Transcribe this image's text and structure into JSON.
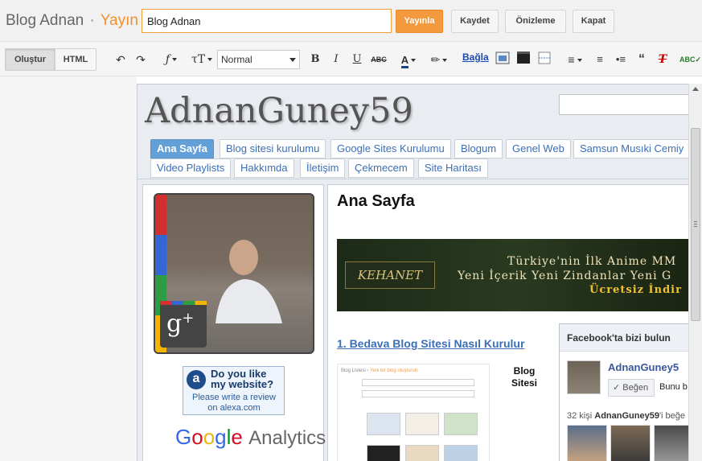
{
  "header": {
    "app_name": "Blog Adnan",
    "separator": "·",
    "section": "Yayın",
    "post_title_value": "Blog Adnan",
    "buttons": {
      "publish": "Yayınla",
      "save": "Kaydet",
      "preview": "Önizleme",
      "close": "Kapat"
    }
  },
  "toolbar": {
    "mode_compose": "Oluştur",
    "mode_html": "HTML",
    "format_value": "Normal",
    "link_label": "Bağla",
    "icons": [
      "undo-icon",
      "redo-icon",
      "font-icon",
      "font-size-icon",
      "bold-icon",
      "italic-icon",
      "underline-icon",
      "strikethrough-icon",
      "text-color-icon",
      "highlight-icon",
      "image-icon",
      "video-icon",
      "jump-break-icon",
      "align-icon",
      "numbered-list-icon",
      "bullet-list-icon",
      "quote-icon",
      "remove-format-icon",
      "spellcheck-icon"
    ]
  },
  "blog": {
    "logo_text": "AdnanGuney59",
    "tabs": [
      {
        "label": "Ana Sayfa",
        "active": true
      },
      {
        "label": "Blog sitesi kurulumu"
      },
      {
        "label": "Google Sites Kurulumu"
      },
      {
        "label": "Blogum"
      },
      {
        "label": "Genel Web"
      },
      {
        "label": "Samsun Musıki Cemiy"
      },
      {
        "label": "Video Playlists"
      },
      {
        "label": "Hakkımda"
      },
      {
        "label": "İletişim"
      },
      {
        "label": "Çekmecem"
      },
      {
        "label": "Site Haritası"
      }
    ],
    "page_title": "Ana Sayfa",
    "banner": {
      "logo": "KEHANET",
      "line1": "Türkiye'nin İlk Anime MM",
      "line2": "Yeni İçerik Yeni Zindanlar Yeni G",
      "line3": "Ücretsiz İndir"
    },
    "post_link": "1. Bedava Blog Sitesi Nasıl Kurulur",
    "thumbnail": {
      "crumb_left": "Blog Listesi",
      "crumb_sep": "›",
      "crumb_right": "Yeni bir blog oluşturun",
      "title_text": "Blog Sitesi"
    },
    "sidebar": {
      "alexa_line1": "Do you like my website?",
      "alexa_line2": "Please write a review on alexa.com",
      "ga_google": [
        "G",
        "o",
        "o",
        "g",
        "l",
        "e"
      ],
      "ga_product": "Analytics"
    },
    "facebook": {
      "header": "Facebook'ta bizi bulun",
      "page_name": "AdnanGuney5",
      "like_button": "✓ Beğen",
      "like_suffix": "Bunu b",
      "count_prefix": "32 kişi",
      "count_name": "AdnanGuney59",
      "count_suffix": "'i beğe"
    }
  },
  "colors": {
    "accent_orange": "#f39a3f",
    "link_blue": "#3b6fb6",
    "tab_active": "#64a0d8",
    "facebook_blue": "#3b5998"
  }
}
